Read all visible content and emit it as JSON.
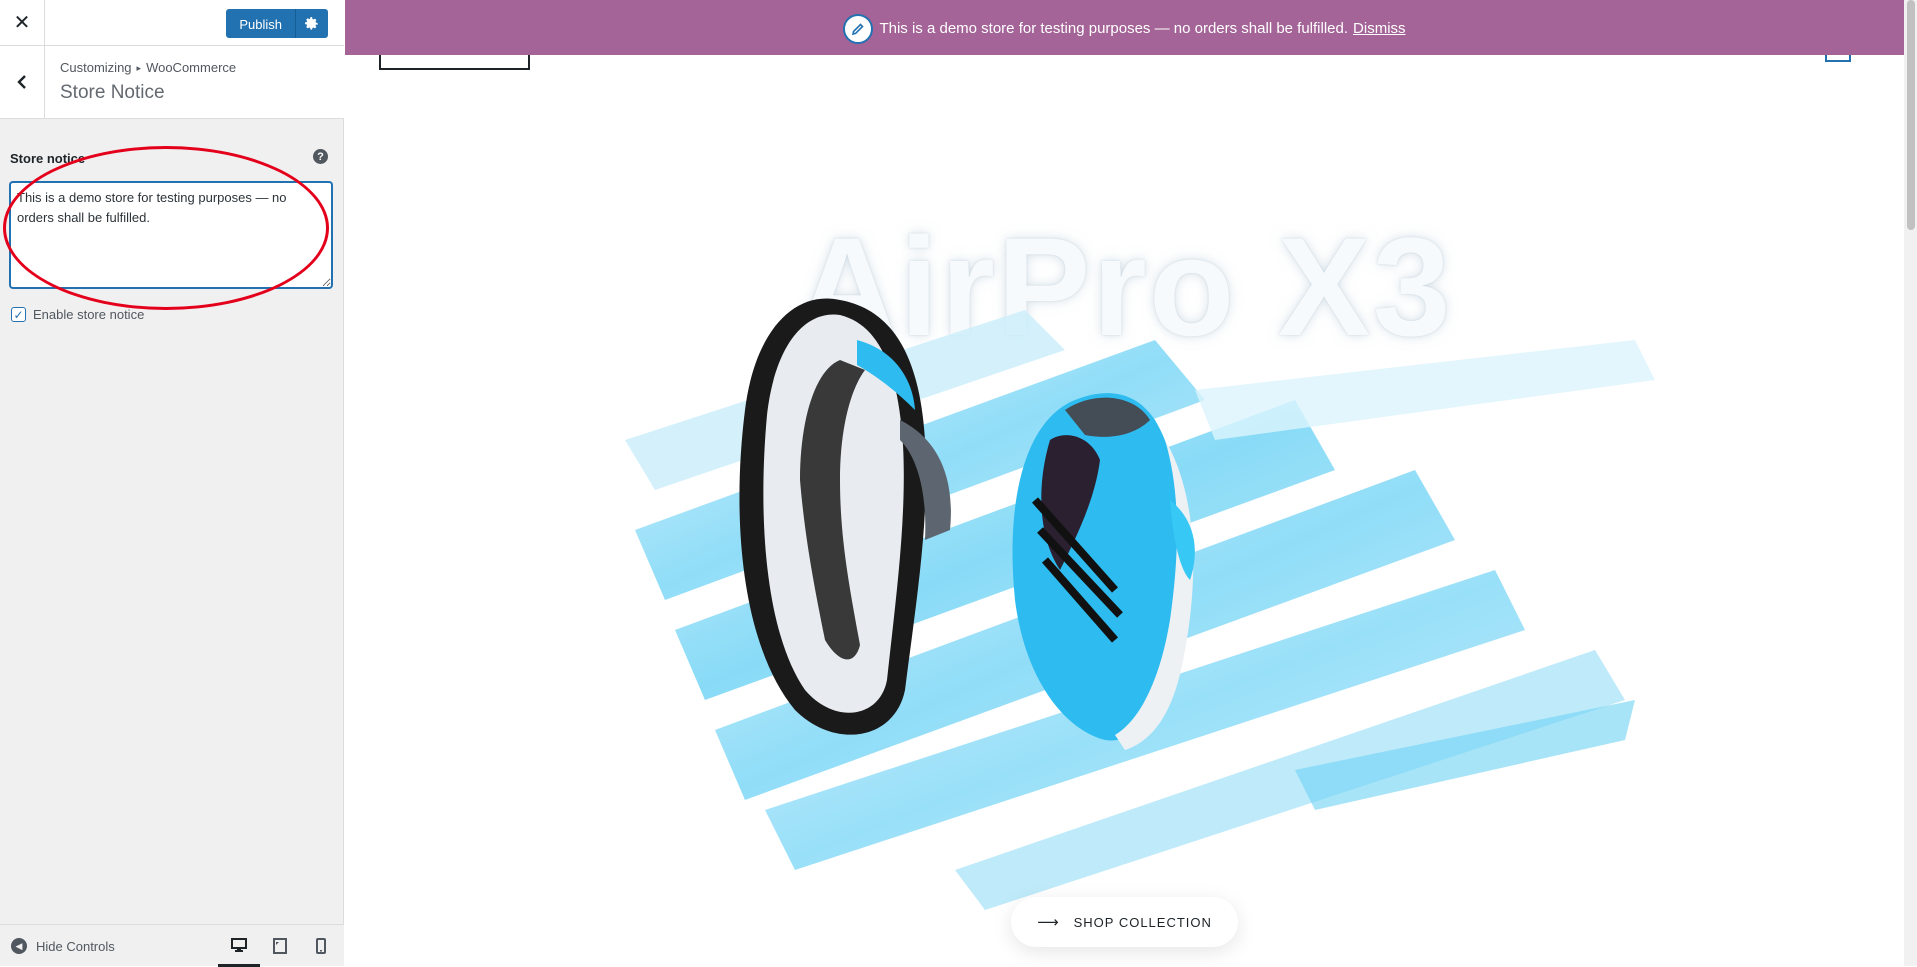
{
  "sidebar": {
    "close_icon": "close-icon",
    "publish_label": "Publish",
    "gear_icon": "gear-icon",
    "back_icon": "chevron-left-icon",
    "breadcrumb": [
      "Customizing",
      "WooCommerce"
    ],
    "section_title": "Store Notice",
    "field_label": "Store notice",
    "help_icon_text": "?",
    "textarea_value": "This is a demo store for testing purposes — no orders shall be fulfilled.",
    "enable_label": "Enable store notice",
    "enable_checked": true,
    "hide_controls_label": "Hide Controls"
  },
  "preview": {
    "banner_text": "This is a demo store for testing purposes — no orders shall be fulfilled.",
    "dismiss_label": "Dismiss",
    "banner_color": "#a46497",
    "hero_title": "AirPro X3",
    "shop_button_label": "SHOP COLLECTION",
    "accent_color": "#2ebcf0"
  }
}
